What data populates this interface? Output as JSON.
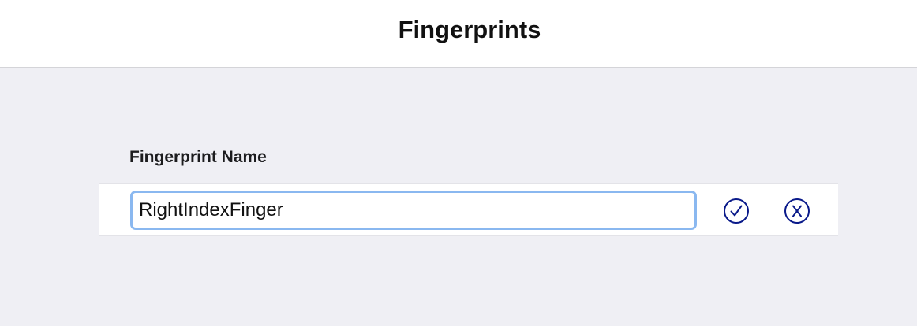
{
  "header": {
    "title": "Fingerprints"
  },
  "form": {
    "section_label": "Fingerprint Name",
    "name_value": "RightIndexFinger",
    "confirm_icon": "checkmark-circle-icon",
    "cancel_icon": "x-circle-icon"
  },
  "colors": {
    "accent": "#0a1a8a",
    "focus_ring": "#8ab8f0",
    "background": "#efeff4"
  }
}
